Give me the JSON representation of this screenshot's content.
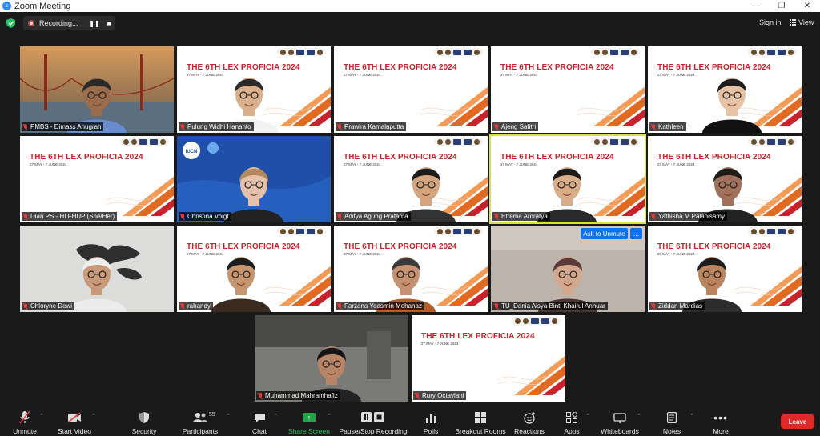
{
  "window": {
    "title": "Zoom Meeting"
  },
  "topbar": {
    "recording_label": "Recording...",
    "signin_label": "Sign in",
    "view_label": "View"
  },
  "slide": {
    "title": "THE 6TH LEX PROFICIA 2024",
    "date": "27 MAY - 7 JUNE 2024"
  },
  "participants": [
    {
      "name": "PMBS - Dimass Anugrah"
    },
    {
      "name": "Pulung Widhi Hananto"
    },
    {
      "name": "Prawira Kamalaputta"
    },
    {
      "name": "Ajeng Safitri"
    },
    {
      "name": "Kathleen"
    },
    {
      "name": "Dian PS - HI FHUP (She/Her)"
    },
    {
      "name": "Christina Voigt"
    },
    {
      "name": "Aditya Agung Pratama"
    },
    {
      "name": "Efrema Ardratya"
    },
    {
      "name": "Yathisha M Palanisamy"
    },
    {
      "name": "Chloryne Dewi"
    },
    {
      "name": "rahandy"
    },
    {
      "name": "Farzana Yeasmin Mehanaz"
    },
    {
      "name": "TU_Dania Aisya Binti Khairul Annuar"
    },
    {
      "name": "Ziddan Mardias"
    },
    {
      "name": "Muhammad Mahramhafiz"
    },
    {
      "name": "Rury Octaviani"
    }
  ],
  "tile_extra": {
    "iucn": "IUCN",
    "ask_to_unmute": "Ask to Unmute",
    "more_dots": "..."
  },
  "toolbar": {
    "unmute": "Unmute",
    "start_video": "Start Video",
    "security": "Security",
    "participants": "Participants",
    "participants_count": "55",
    "chat": "Chat",
    "share_screen": "Share Screen",
    "pause_stop_recording": "Pause/Stop Recording",
    "polls": "Polls",
    "breakout_rooms": "Breakout Rooms",
    "reactions": "Reactions",
    "apps": "Apps",
    "whiteboards": "Whiteboards",
    "notes": "Notes",
    "more": "More",
    "leave": "Leave"
  },
  "colors": {
    "accent_blue": "#0e72ed",
    "leave_red": "#e02828",
    "share_green": "#22a447",
    "slide_red": "#c8232c",
    "active_speaker_border": "#d7e04a"
  }
}
